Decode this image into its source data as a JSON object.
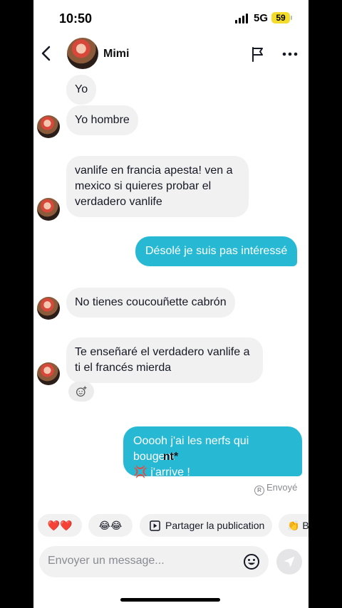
{
  "status_bar": {
    "time": "10:50",
    "network": "5G",
    "battery": "59"
  },
  "header": {
    "contact_name": "Mimi"
  },
  "messages": [
    {
      "side": "in",
      "text": "Yo"
    },
    {
      "side": "in",
      "text": "Yo hombre"
    },
    {
      "side": "in",
      "text": "vanlife en francia apesta! ven a mexico si quieres probar el verdadero vanlife"
    },
    {
      "side": "out",
      "text": "Désolé je suis pas intéressé"
    },
    {
      "side": "in",
      "text": "No tienes coucouñette cabrón"
    },
    {
      "side": "in",
      "text": "Te enseñaré el verdadero vanlife a ti el francés mierda"
    },
    {
      "side": "out",
      "text": "Ooooh j'ai les nerfs qui bougent",
      "suffix": "nt*",
      "emoji": "💢",
      "line2": " j'arrive !"
    }
  ],
  "sent_status": "Envoyé",
  "quick_replies": {
    "hearts": "❤️❤️",
    "laugh": "😂😂",
    "share_label": "Partager la publication",
    "clap": "👏",
    "clap_text": "B"
  },
  "composer": {
    "placeholder": "Envoyer un message..."
  },
  "colors": {
    "outgoing_bubble": "#27b9d4",
    "incoming_bubble": "#f1f1f2",
    "battery": "#f3dc2b"
  },
  "icons": [
    "back-icon",
    "flag-icon",
    "more-icon",
    "add-reaction-icon",
    "sent-icon",
    "play-icon",
    "emoji-icon",
    "send-icon"
  ]
}
